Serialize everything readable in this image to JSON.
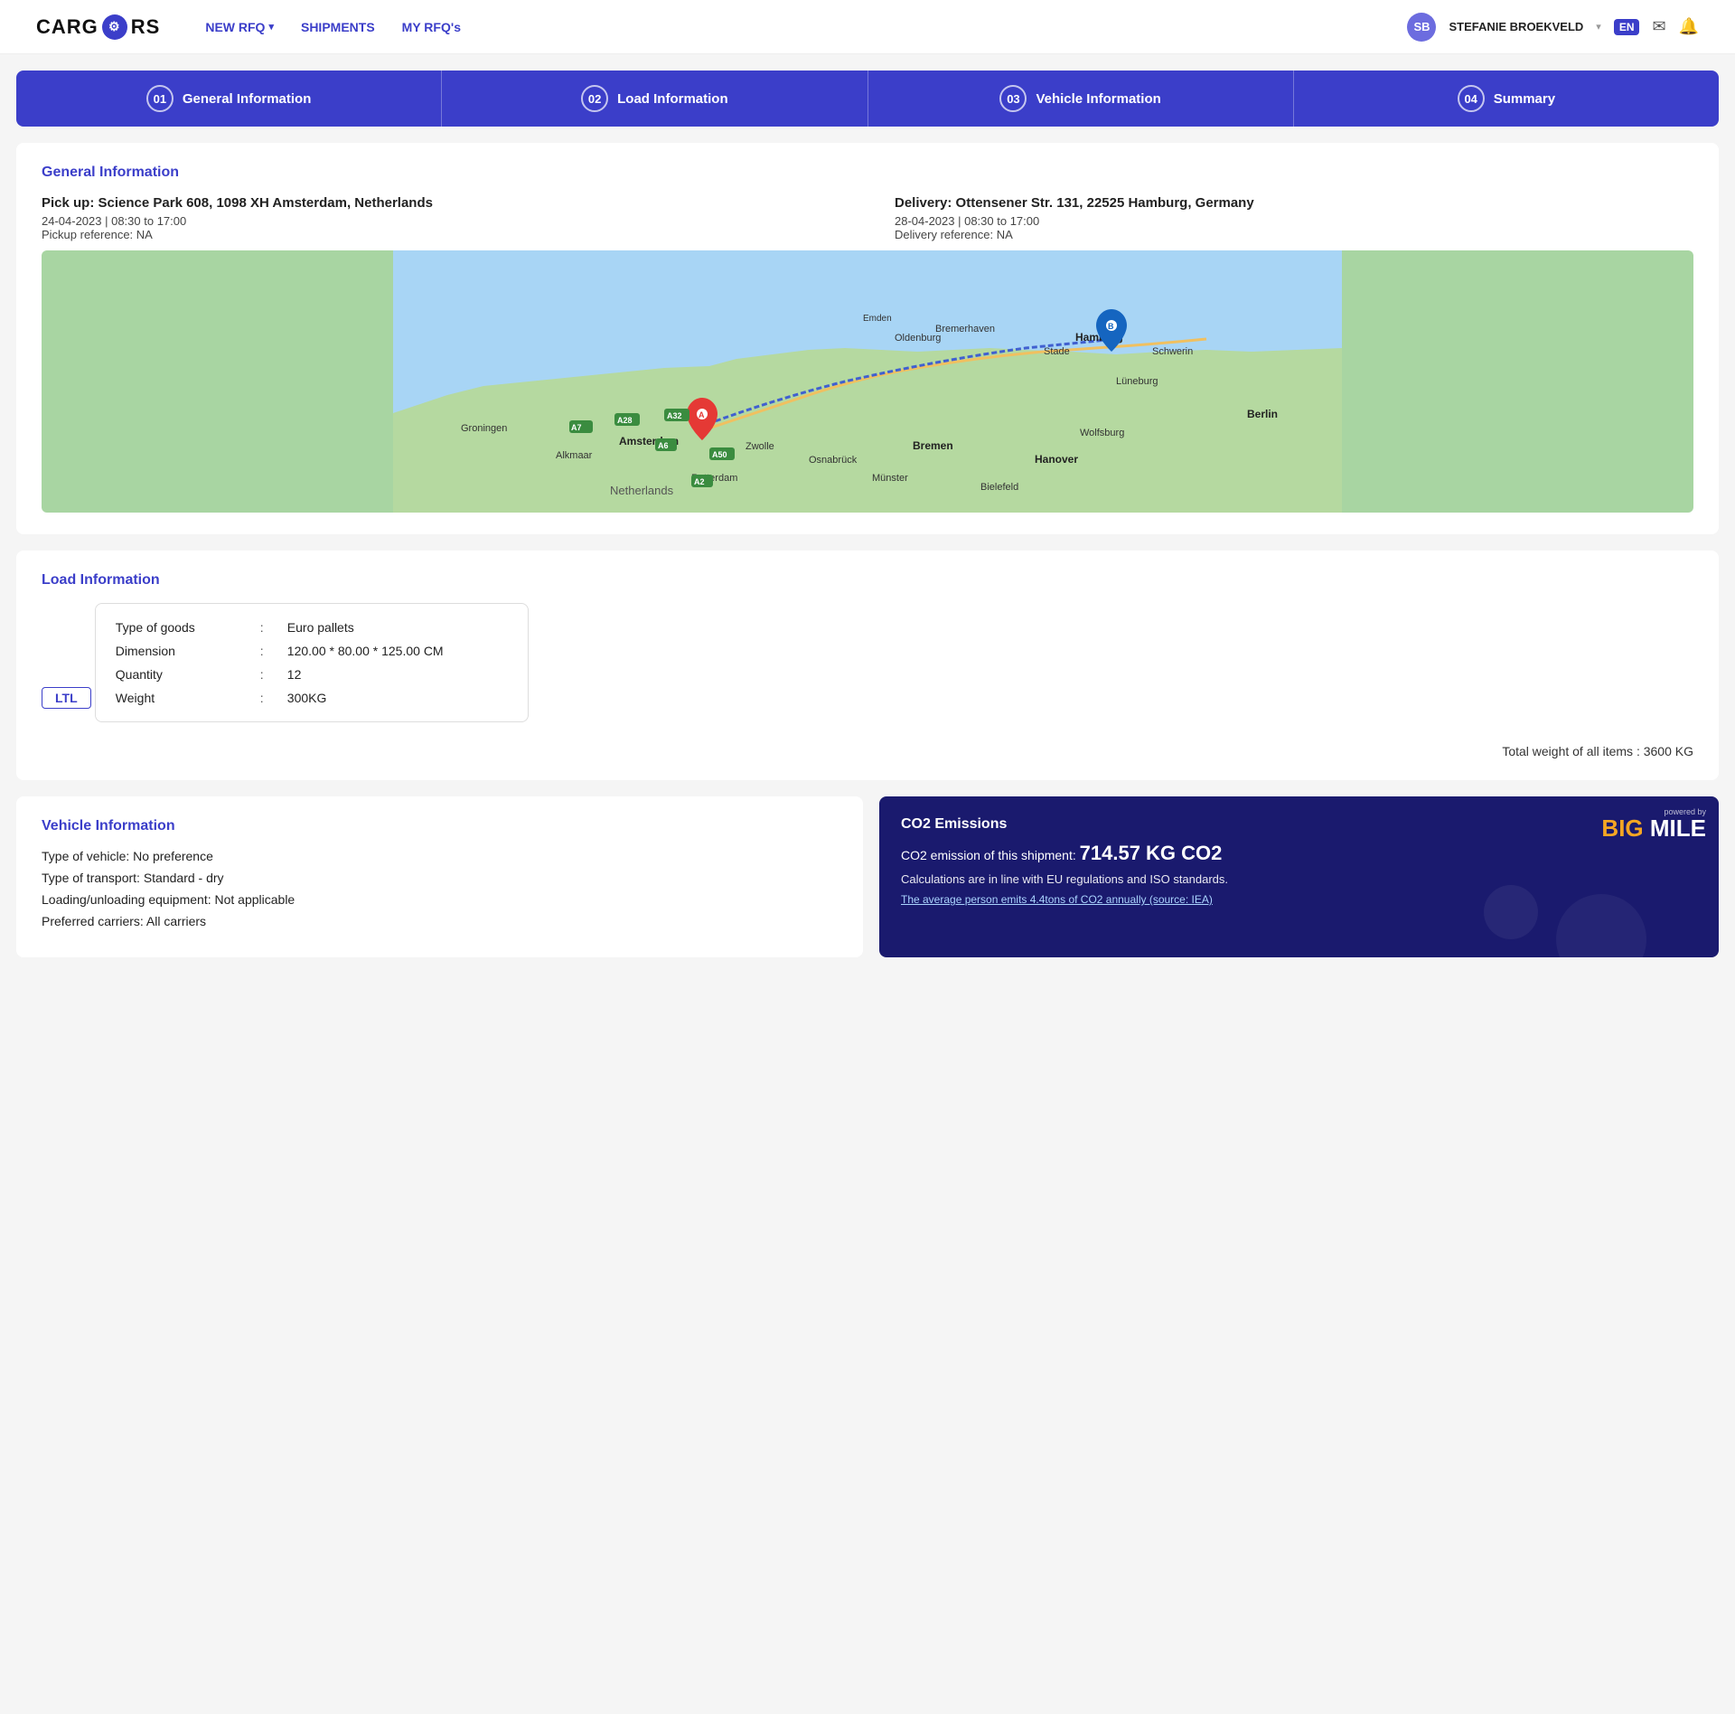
{
  "header": {
    "logo_text_1": "CARG",
    "logo_text_2": "RS",
    "nav": [
      {
        "label": "NEW RFQ",
        "has_dropdown": true
      },
      {
        "label": "SHIPMENTS",
        "has_dropdown": false
      },
      {
        "label": "MY RFQ's",
        "has_dropdown": false
      }
    ],
    "user_name": "STEFANIE BROEKVELD",
    "lang": "EN"
  },
  "progress": {
    "steps": [
      {
        "number": "01",
        "label": "General Information"
      },
      {
        "number": "02",
        "label": "Load Information"
      },
      {
        "number": "03",
        "label": "Vehicle Information"
      },
      {
        "number": "04",
        "label": "Summary"
      }
    ]
  },
  "general_info": {
    "section_title": "General Information",
    "pickup": {
      "main": "Pick up: Science Park 608, 1098 XH Amsterdam, Netherlands",
      "date": "24-04-2023 | 08:30 to 17:00",
      "ref": "Pickup reference: NA"
    },
    "delivery": {
      "main": "Delivery: Ottensener Str. 131, 22525 Hamburg, Germany",
      "date": "28-04-2023 | 08:30 to 17:00",
      "ref": "Delivery reference: NA"
    }
  },
  "load_info": {
    "section_title": "Load Information",
    "badge": "LTL",
    "goods": [
      {
        "label": "Type of goods",
        "sep": ":",
        "value": "Euro pallets"
      },
      {
        "label": "Dimension",
        "sep": ":",
        "value": "120.00 * 80.00 * 125.00 CM"
      },
      {
        "label": "Quantity",
        "sep": ":",
        "value": "12"
      },
      {
        "label": "Weight",
        "sep": ":",
        "value": "300KG"
      }
    ],
    "total_weight_label": "Total weight of all items :",
    "total_weight_value": "3600 KG"
  },
  "vehicle_info": {
    "section_title": "Vehicle Information",
    "lines": [
      "Type of vehicle: No preference",
      "Type of transport: Standard - dry",
      "Loading/unloading equipment: Not applicable",
      "Preferred carriers: All carriers"
    ]
  },
  "co2": {
    "powered_by": "powered by",
    "big": "BIG",
    "mile": "MILE",
    "title": "CO2 Emissions",
    "amount_prefix": "CO2 emission of this shipment:",
    "amount": "714.57 KG CO2",
    "note": "Calculations are in line with EU regulations and ISO standards.",
    "link": "The average person emits 4.4tons of CO2 annually (source: IEA)"
  }
}
